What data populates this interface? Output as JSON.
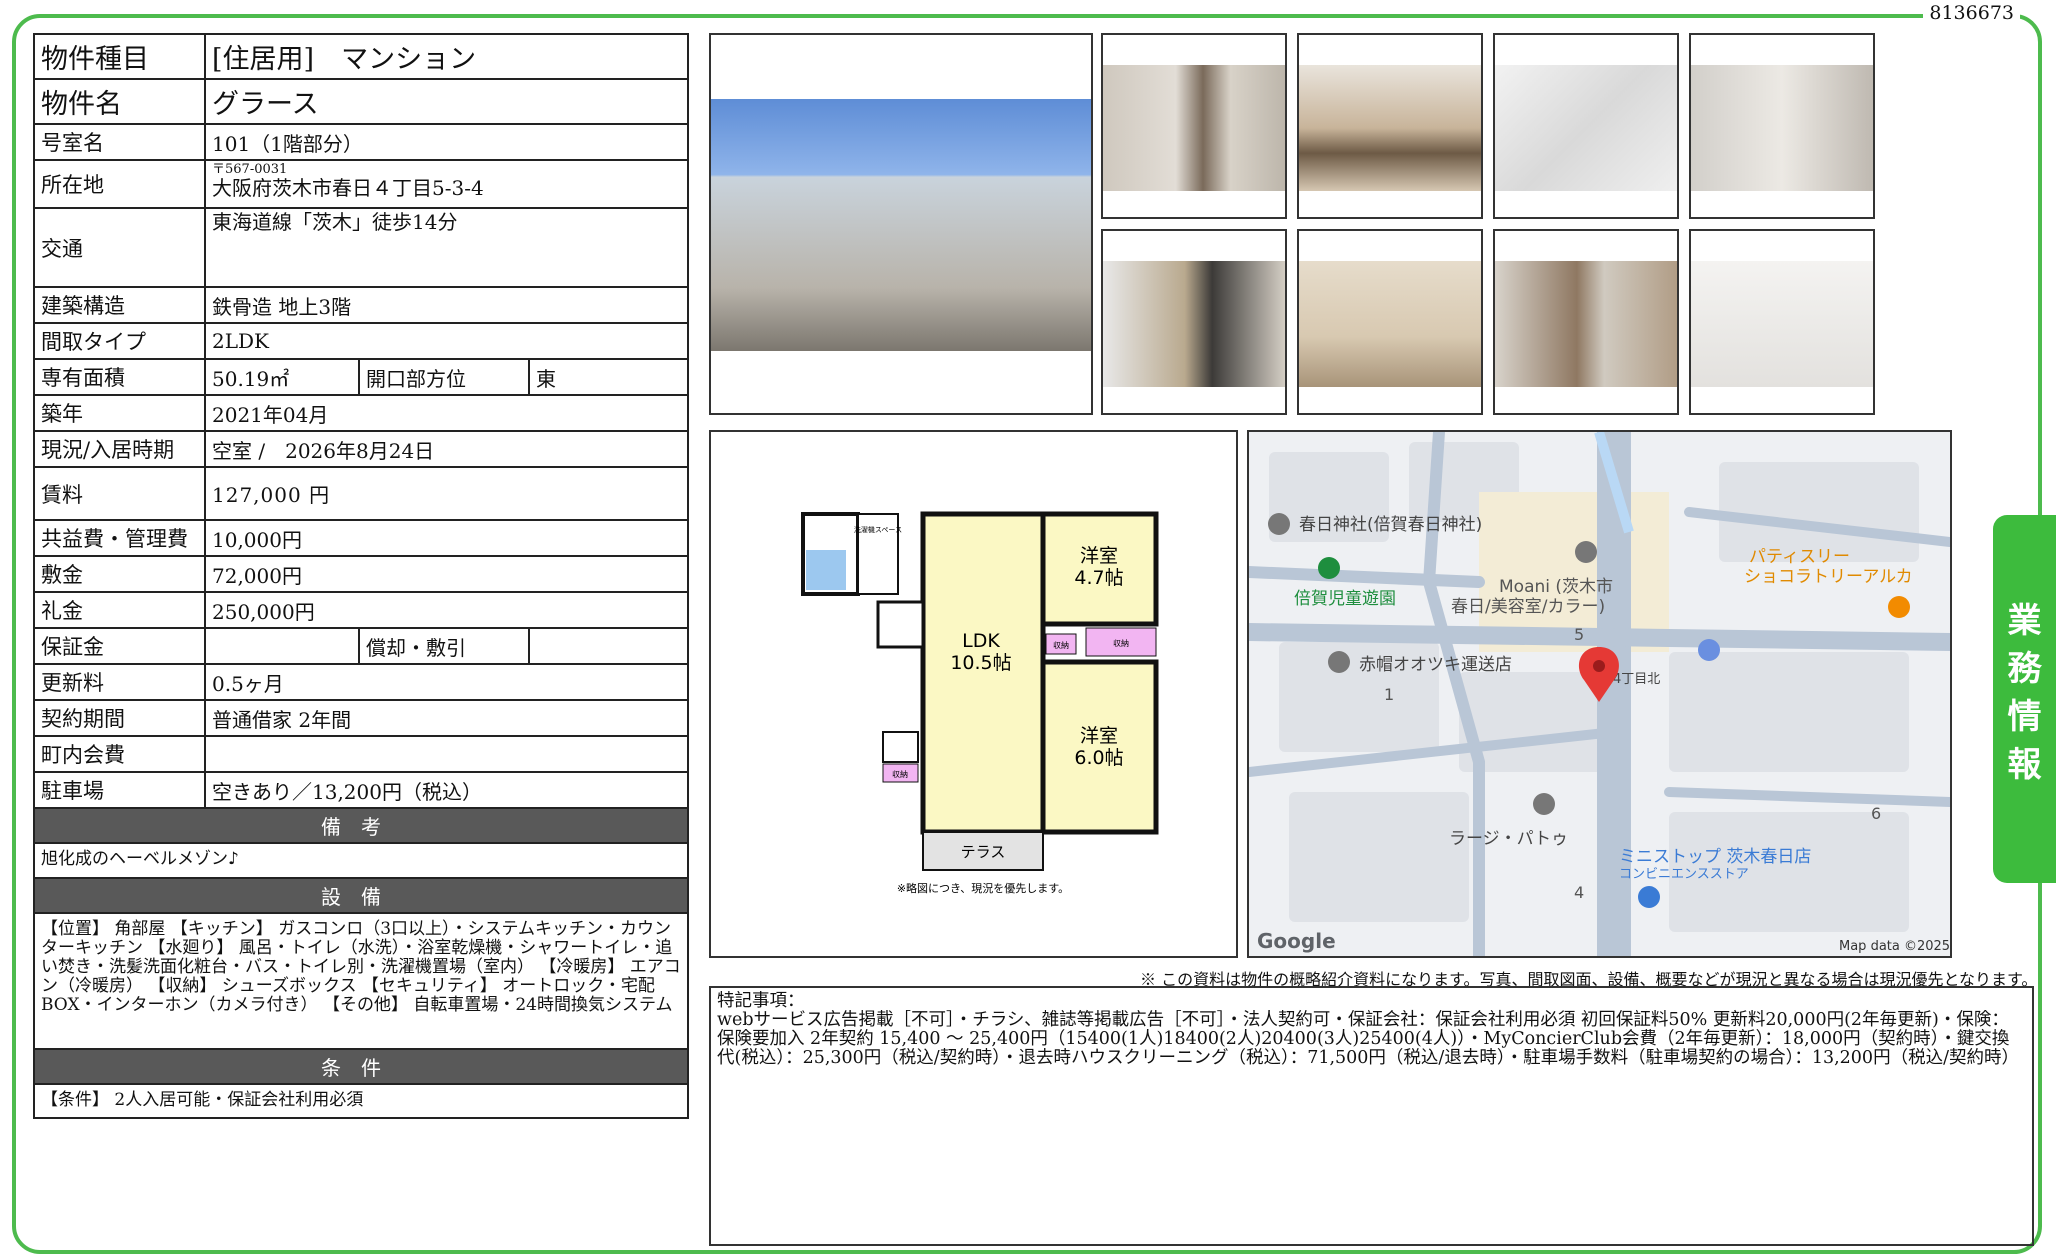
{
  "property_id": "8136673",
  "spec": {
    "type_label": "物件種目",
    "type_value": "[住居用]　マンション",
    "name_label": "物件名",
    "name_value": "グラース",
    "room_label": "号室名",
    "room_value": "101（1階部分）",
    "address_label": "所在地",
    "zip": "〒567-0031",
    "address": "大阪府茨木市春日４丁目5-3-4",
    "transit_label": "交通",
    "transit_value": "東海道線「茨木」徒歩14分",
    "structure_label": "建築構造",
    "structure_value": "鉄骨造 地上3階",
    "layout_label": "間取タイプ",
    "layout_value": "2LDK",
    "area_label": "専有面積",
    "area_value": "50.19㎡",
    "direction_label": "開口部方位",
    "direction_value": "東",
    "built_label": "築年",
    "built_value": "2021年04月",
    "status_label": "現況/入居時期",
    "status_value": "空室 /　2026年8月24日",
    "rent_label": "賃料",
    "rent_value": "127,000 円",
    "fee_label": "共益費・管理費",
    "fee_value": "10,000円",
    "deposit_label": "敷金",
    "deposit_value": "72,000円",
    "key_money_label": "礼金",
    "key_money_value": "250,000円",
    "guarantee_label": "保証金",
    "guarantee_value": "",
    "amortization_label": "償却・敷引",
    "amortization_value": "",
    "renewal_label": "更新料",
    "renewal_value": "0.5ヶ月",
    "contract_label": "契約期間",
    "contract_value": "普通借家 2年間",
    "community_label": "町内会費",
    "community_value": "",
    "parking_label": "駐車場",
    "parking_value": "空きあり／13,200円（税込）"
  },
  "sections": {
    "remarks_head": "備考",
    "remarks_text": "旭化成のヘーベルメゾン♪",
    "equipment_head": "設備",
    "equipment_text": "【位置】 角部屋 【キッチン】 ガスコンロ（3口以上）・システムキッチン・カウンターキッチン 【水廻り】 風呂・トイレ（水洗）・浴室乾燥機・シャワートイレ・追い焚き・洗髪洗面化粧台・バス・トイレ別・洗濯機置場（室内） 【冷暖房】 エアコン（冷暖房） 【収納】 シューズボックス 【セキュリティ】 オートロック・宅配BOX・インターホン（カメラ付き） 【その他】 自転車置場・24時間換気システム",
    "conditions_head": "条件",
    "conditions_text": "【条件】 2人入居可能・保証会社利用必須"
  },
  "floorplan": {
    "labels": {
      "room1": "洋室",
      "room1_size": "4.7帖",
      "ldk": "LDK",
      "ldk_size": "10.5帖",
      "room2": "洋室",
      "room2_size": "6.0帖",
      "terrace": "テラス",
      "storage": "収納",
      "washer": "洗濯機スペース",
      "note": "※略図につき、現況を優先します。"
    }
  },
  "map": {
    "places": [
      "春日神社(倍賀春日神社)",
      "倍賀児童遊園",
      "Moani (茨木市",
      "春日/美容室/カラー)",
      "パティスリー",
      "ショコラトリーアルカ",
      "赤帽オオツキ運送店",
      "春日4丁目北",
      "ラージ・パトゥ",
      "ミニストップ 茨木春日店",
      "コンビニエンスストア"
    ],
    "numbers": [
      "5",
      "1",
      "6",
      "4"
    ],
    "logo": "Google",
    "credit": "Map data ©2025"
  },
  "disclaimer": "※ この資料は物件の概略紹介資料になります。写真、間取図面、設備、概要などが現況と異なる場合は現況優先となります。",
  "special_notes": {
    "title": "特記事項：",
    "text": "webサービス広告掲載［不可］・チラシ、雑誌等掲載広告［不可］・法人契約可・保証会社：保証会社利用必須 初回保証料50% 更新料20,000円(2年毎更新)・保険：保険要加入 2年契約 15,400 ～ 25,400円（15400(1人)18400(2人)20400(3人)25400(4人)）・MyConcierClub会費（2年毎更新）：18,000円（契約時）・鍵交換代(税込）：25,300円（税込/契約時）・退去時ハウスクリーニング（税込）：71,500円（税込/退去時）・駐車場手数料（駐車場契約の場合）：13,200円（税込/契約時）"
  },
  "side_tab": [
    "業",
    "務",
    "情",
    "報"
  ],
  "colors": {
    "frame": "#4dbb4d",
    "section_head": "#595959",
    "side_tab": "#3dbb3d",
    "map_pin": "#e53935"
  }
}
